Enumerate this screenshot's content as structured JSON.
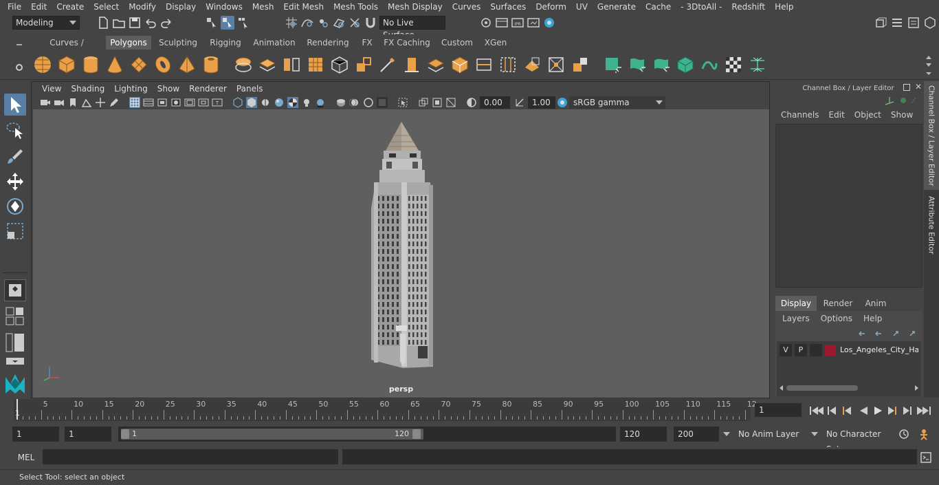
{
  "menubar": {
    "items": [
      "File",
      "Edit",
      "Create",
      "Select",
      "Modify",
      "Display",
      "Windows",
      "Mesh",
      "Edit Mesh",
      "Mesh Tools",
      "Mesh Display",
      "Curves",
      "Surfaces",
      "Deform",
      "UV",
      "Generate",
      "Cache",
      "- 3DtoAll -",
      "Redshift",
      "Help"
    ]
  },
  "statusline": {
    "workspace": "Modeling",
    "live_surface": "No Live Surface"
  },
  "shelf": {
    "tabs": [
      "Curves / Surfaces",
      "Polygons",
      "Sculpting",
      "Rigging",
      "Animation",
      "Rendering",
      "FX",
      "FX Caching",
      "Custom",
      "XGen"
    ],
    "active_tab": "Polygons"
  },
  "viewport": {
    "menu": [
      "View",
      "Shading",
      "Lighting",
      "Show",
      "Renderer",
      "Panels"
    ],
    "exposure": "0.00",
    "gamma": "1.00",
    "color_space": "sRGB gamma",
    "camera_label": "persp"
  },
  "channelbox": {
    "title": "Channel Box / Layer Editor",
    "menu": [
      "Channels",
      "Edit",
      "Object",
      "Show"
    ],
    "layer_tabs": [
      "Display",
      "Render",
      "Anim"
    ],
    "active_layer_tab": "Display",
    "layer_menu": [
      "Layers",
      "Options",
      "Help"
    ],
    "layer": {
      "v": "V",
      "p": "P",
      "name": "Los_Angeles_City_Hall",
      "color": "#9b1a2f"
    }
  },
  "sidetabs": {
    "channel_box": "Channel Box / Layer Editor",
    "attribute_editor": "Attribute Editor"
  },
  "timeline": {
    "ticks": [
      "5",
      "10",
      "15",
      "20",
      "25",
      "30",
      "35",
      "40",
      "45",
      "50",
      "55",
      "60",
      "65",
      "70",
      "75",
      "80",
      "85",
      "90",
      "95",
      "100",
      "105",
      "110",
      "115",
      "12"
    ],
    "current_marker": "1",
    "current_frame": "1"
  },
  "range": {
    "start": "1",
    "playback_start": "1",
    "slider_start": "1",
    "slider_end": "120",
    "playback_end": "120",
    "end": "200",
    "anim_layer": "No Anim Layer",
    "character_set": "No Character Set"
  },
  "cmdline": {
    "label": "MEL"
  },
  "helpline": {
    "text": "Select Tool: select an object"
  },
  "colors": {
    "accent": "#5a7fa6",
    "shelf_icon": "#e8a04a",
    "shelf_icon_green": "#3fb38f"
  }
}
